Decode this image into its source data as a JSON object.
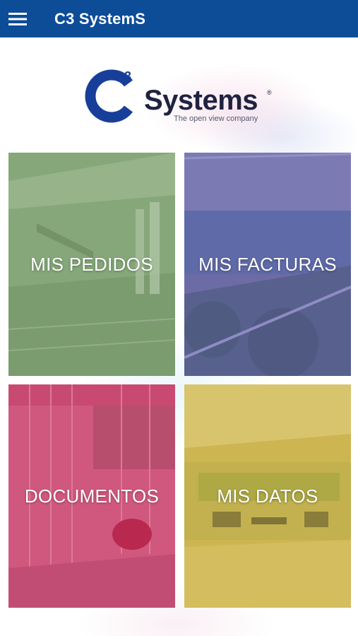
{
  "appbar": {
    "title": "C3 SystemS",
    "menu_icon": "hamburger-menu-icon",
    "background": "#0d4c97"
  },
  "logo": {
    "mark": "C",
    "superscript": "3",
    "name": "Systems",
    "registered": "®",
    "tagline": "The open view company"
  },
  "tiles": [
    {
      "label": "MIS PEDIDOS",
      "color": "#86a77a"
    },
    {
      "label": "MIS FACTURAS",
      "color": "#6d6ba6"
    },
    {
      "label": "DOCUMENTOS",
      "color": "#d0587f"
    },
    {
      "label": "MIS DATOS",
      "color": "#cdb552"
    }
  ]
}
